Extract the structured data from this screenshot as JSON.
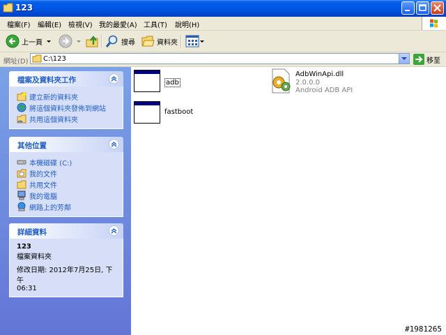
{
  "window": {
    "title": "123"
  },
  "menu": [
    "檔案(F)",
    "編輯(E)",
    "檢視(V)",
    "我的最愛(A)",
    "工具(T)",
    "說明(H)"
  ],
  "toolbar": {
    "back": "上一頁",
    "search": "搜尋",
    "folders": "資料夾"
  },
  "address": {
    "label": "網址(D)",
    "path": "C:\\123",
    "go": "移至"
  },
  "tasks_panel": {
    "title": "檔案及資料夾工作",
    "items": [
      "建立新的資料夾",
      "將這個資料夾發佈到網站",
      "共用這個資料夾"
    ]
  },
  "places_panel": {
    "title": "其他位置",
    "items": [
      "本機磁碟 (C:)",
      "我的文件",
      "共用文件",
      "我的電腦",
      "網路上的芳鄰"
    ]
  },
  "details_panel": {
    "title": "詳細資料",
    "name": "123",
    "type": "檔案資料夾",
    "modified_line1": "修改日期: 2012年7月25日, 下午",
    "modified_line2": "06:31"
  },
  "files": [
    {
      "name": "adb",
      "icon": "window-app-icon",
      "selected": true
    },
    {
      "name": "fastboot",
      "icon": "window-app-icon"
    },
    {
      "name": "AdbWinApi.dll",
      "version": "2.0.0.0",
      "description": "Android ADB API",
      "icon": "dll-gear-icon"
    }
  ],
  "watermark": "#1981265"
}
